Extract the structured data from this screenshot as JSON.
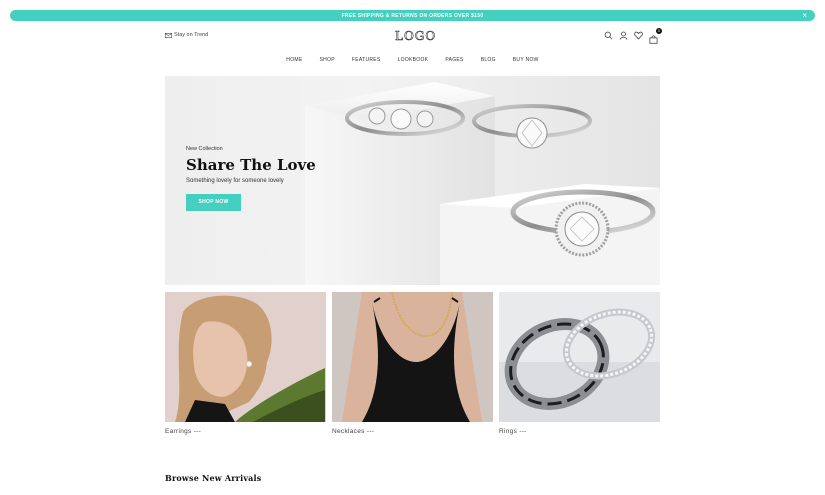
{
  "announcement": {
    "text": "FREE SHIPPING & RETURNS ON ORDERS OVER $150",
    "close": "×"
  },
  "header": {
    "stay_label": "Stay on Trend",
    "logo": "LOGO",
    "cart_count": "0"
  },
  "nav": {
    "items": [
      "HOME",
      "SHOP",
      "FEATURES",
      "LOOKBOOK",
      "PAGES",
      "BLOG",
      "BUY NOW"
    ]
  },
  "hero": {
    "kicker": "New Collection",
    "title": "Share The Love",
    "subtitle": "Something lovely for someone lovely",
    "button": "SHOP NOW"
  },
  "categories": [
    {
      "label": "Earrings ---"
    },
    {
      "label": "Necklaces ---"
    },
    {
      "label": "Rings ---"
    }
  ],
  "section": {
    "title": "Browse New Arrivals"
  },
  "colors": {
    "accent": "#45cfc0"
  }
}
